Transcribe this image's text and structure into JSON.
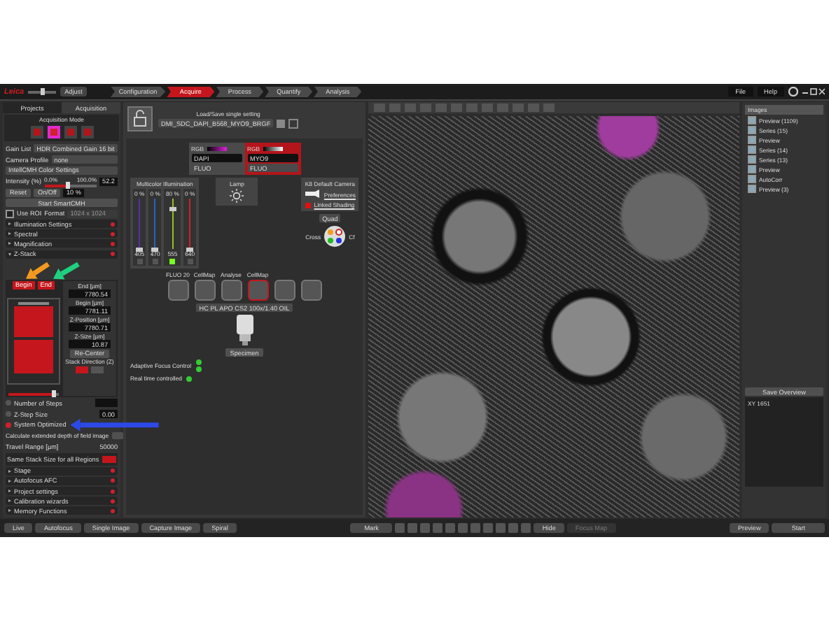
{
  "top_bar": {
    "logo": "Leica",
    "zoom_slider": {
      "level": 0.5
    },
    "adjust_button": "Adjust",
    "workflow_tabs": [
      {
        "label": "Configuration",
        "selected": false
      },
      {
        "label": "Acquire",
        "selected": true
      },
      {
        "label": "Process",
        "selected": false
      },
      {
        "label": "Quantify",
        "selected": false
      },
      {
        "label": "Analysis",
        "selected": false
      }
    ],
    "menu": [
      "File",
      "Help"
    ]
  },
  "left_panel": {
    "tabs": [
      {
        "label": "Projects",
        "selected": false
      },
      {
        "label": "Acquisition",
        "selected": true
      }
    ],
    "acquisition_mode": {
      "label": "Acquisition Mode",
      "modes": [
        {
          "selected": false
        },
        {
          "selected": true
        },
        {
          "selected": false
        },
        {
          "selected": false
        }
      ]
    },
    "fields": [
      {
        "label": "Gain List",
        "value": "HDR Combined Gain 16 bit"
      },
      {
        "label": "Camera Profile",
        "value": "none"
      }
    ],
    "color_settings": "IntellCMH Color Settings",
    "intensity": {
      "label": "Intensity (%)",
      "min": "0.0%",
      "max": "100.0%",
      "level": 0.45,
      "reading": "52.2",
      "reset": "Reset",
      "on_off": "On/Off",
      "step": "10 %",
      "smart": "Start SmartCMH"
    },
    "roi": {
      "label": "Use ROI",
      "checked": false,
      "format": "Format",
      "format_value": "1024 x 1024"
    },
    "sections_top": [
      {
        "label": "Illumination Settings",
        "expanded": false
      },
      {
        "label": "Spectral",
        "expanded": false
      },
      {
        "label": "Magnification",
        "expanded": false
      },
      {
        "label": "Z-Stack",
        "expanded": true
      }
    ],
    "zstack": {
      "begin": "Begin",
      "end": "End",
      "fields": [
        {
          "label": "End [µm]",
          "value": "7780.54"
        },
        {
          "label": "Begin [µm]",
          "value": "7781.11"
        },
        {
          "label": "Z-Position [µm]",
          "value": "7780.71"
        },
        {
          "label": "Z-Size [µm]",
          "value": "10.87"
        }
      ],
      "recenter": "Re-Center",
      "direction_label": "Stack Direction (Z)",
      "range_slider": {
        "level": 0.9
      },
      "options": [
        {
          "kind": "field",
          "label": "Number of Steps",
          "selected": false
        },
        {
          "kind": "field",
          "label": "Z-Step Size",
          "value": "0.00",
          "selected": false
        },
        {
          "kind": "plain",
          "label": "System Optimized",
          "selected": true
        }
      ],
      "edf": "Calculate extended depth of field image",
      "travel_label": "Travel Range [µm]",
      "travel_value": "50000",
      "same_size": "Same Stack Size for all Regions",
      "same_size_on": true
    },
    "sections_bottom": [
      {
        "label": "Stage",
        "expanded": false
      },
      {
        "label": "Autofocus AFC",
        "expanded": false
      },
      {
        "label": "Project settings",
        "expanded": false
      },
      {
        "label": "Calibration wizards",
        "expanded": false
      },
      {
        "label": "Memory Functions",
        "expanded": false
      }
    ]
  },
  "hardware_panel": {
    "setting_label": "Load/Save single setting",
    "setting_value": "DMI_SDC_DAPI_B568_MYO9_BRGF",
    "cubes": [
      {
        "name": "RGB",
        "filter": "DAPI",
        "mode": "FLUO",
        "selected": false
      },
      {
        "name": "RGB",
        "filter": "MYO9",
        "mode": "FLUO",
        "selected": true
      }
    ],
    "illumination": {
      "title": "Multicolor Illumination",
      "channels": [
        {
          "reading": "0 %",
          "level": 0,
          "wavelength": "405",
          "color": "#5b2ea6",
          "on": false
        },
        {
          "reading": "0 %",
          "level": 0,
          "wavelength": "470",
          "color": "#2a63c2",
          "on": false
        },
        {
          "reading": "80 %",
          "level": 0.8,
          "wavelength": "555",
          "color": "#8fc21f",
          "on": true
        },
        {
          "reading": "0 %",
          "level": 0,
          "wavelength": "640",
          "color": "#cf2222",
          "on": false
        }
      ]
    },
    "lamp": "Lamp",
    "camera": {
      "title": "K8 Default Camera",
      "preferences": "Preferences",
      "linked_shading": "Linked Shading",
      "linked_checked": true
    },
    "filter_wheel": {
      "value": "Quad",
      "left": "Cross",
      "right": "Cf"
    },
    "turret": [
      {
        "label": "FLUO 20",
        "selected": false
      },
      {
        "label": "CellMap",
        "selected": false
      },
      {
        "label": "Analyse",
        "selected": false
      },
      {
        "label": "CellMap",
        "selected": true
      },
      {
        "selected": false
      },
      {
        "selected": false
      }
    ],
    "objective": "HC PL APO CS2 100x/1.40 OIL",
    "specimen": "Specimen",
    "status": [
      {
        "label": "Adaptive Focus Control",
        "lights": [
          {
            "on": true
          },
          {
            "on": true
          }
        ]
      },
      {
        "label": "Real time controlled",
        "lights": [
          {
            "on": true
          }
        ]
      }
    ]
  },
  "images_panel": {
    "title": "Images",
    "items": [
      {
        "label": "Preview (1109)",
        "checked": true
      },
      {
        "label": "Series (15)",
        "checked": true
      },
      {
        "label": "Preview",
        "checked": true
      },
      {
        "label": "Series (14)",
        "checked": true
      },
      {
        "label": "Series (13)",
        "checked": true
      },
      {
        "label": "Preview",
        "checked": true
      },
      {
        "label": "AutoCorr",
        "checked": true
      },
      {
        "label": "Preview (3)",
        "checked": true
      }
    ],
    "save_overview": "Save Overview",
    "tree_item": "XY 1651"
  },
  "bottom_bar": {
    "left_buttons": [
      "Live",
      "Autofocus",
      "Single Image",
      "Capture Image",
      "Spiral"
    ],
    "mark": "Mark",
    "hide": "Hide",
    "focus_map": {
      "label": "Focus Map",
      "disabled": true
    },
    "preview": "Preview",
    "start": "Start"
  },
  "annotations": [
    {
      "kind": "arrow",
      "color": "#f39a1e"
    },
    {
      "kind": "arrow",
      "color": "#1fd17f"
    },
    {
      "kind": "arrow",
      "color": "#2c49e8"
    }
  ]
}
